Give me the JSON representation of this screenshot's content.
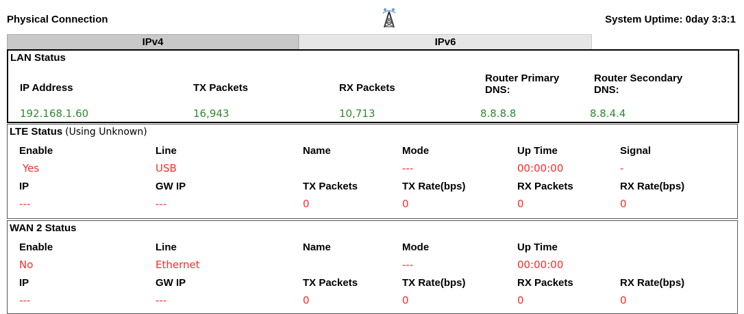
{
  "header": {
    "title": "Physical Connection",
    "uptime": "System Uptime: 0day 3:3:1",
    "icon": "antenna-tower-icon"
  },
  "tabs": [
    {
      "label": "IPv4",
      "active": true
    },
    {
      "label": "IPv6",
      "active": false
    }
  ],
  "lan": {
    "title": "LAN Status",
    "headers": [
      "IP Address",
      "TX Packets",
      "RX Packets",
      "Router Primary DNS:",
      "Router Secondary DNS:"
    ],
    "values": [
      "192.168.1.60",
      "16,943",
      "10,713",
      "8.8.8.8",
      "8.8.4.4"
    ]
  },
  "lte": {
    "title": "LTE Status",
    "subtitle": "(Using Unknown)",
    "row1_headers": [
      "Enable",
      "Line",
      "Name",
      "Mode",
      "Up Time",
      "Signal"
    ],
    "row1_values": [
      "Yes",
      "USB",
      "",
      "---",
      "00:00:00",
      "-"
    ],
    "row2_headers": [
      "IP",
      "GW IP",
      "TX Packets",
      "TX Rate(bps)",
      "RX Packets",
      "RX Rate(bps)"
    ],
    "row2_values": [
      "---",
      "---",
      "0",
      "0",
      "0",
      "0"
    ]
  },
  "wan2": {
    "title": "WAN 2 Status",
    "row1_headers": [
      "Enable",
      "Line",
      "Name",
      "Mode",
      "Up Time"
    ],
    "row1_values": [
      "No",
      "Ethernet",
      "",
      "---",
      "00:00:00"
    ],
    "row2_headers": [
      "IP",
      "GW IP",
      "TX Packets",
      "TX Rate(bps)",
      "RX Packets",
      "RX Rate(bps)"
    ],
    "row2_values": [
      "---",
      "---",
      "0",
      "0",
      "0",
      "0"
    ]
  },
  "colors": {
    "value_green": "#2e8b2e",
    "value_red": "#ff2a2a"
  }
}
